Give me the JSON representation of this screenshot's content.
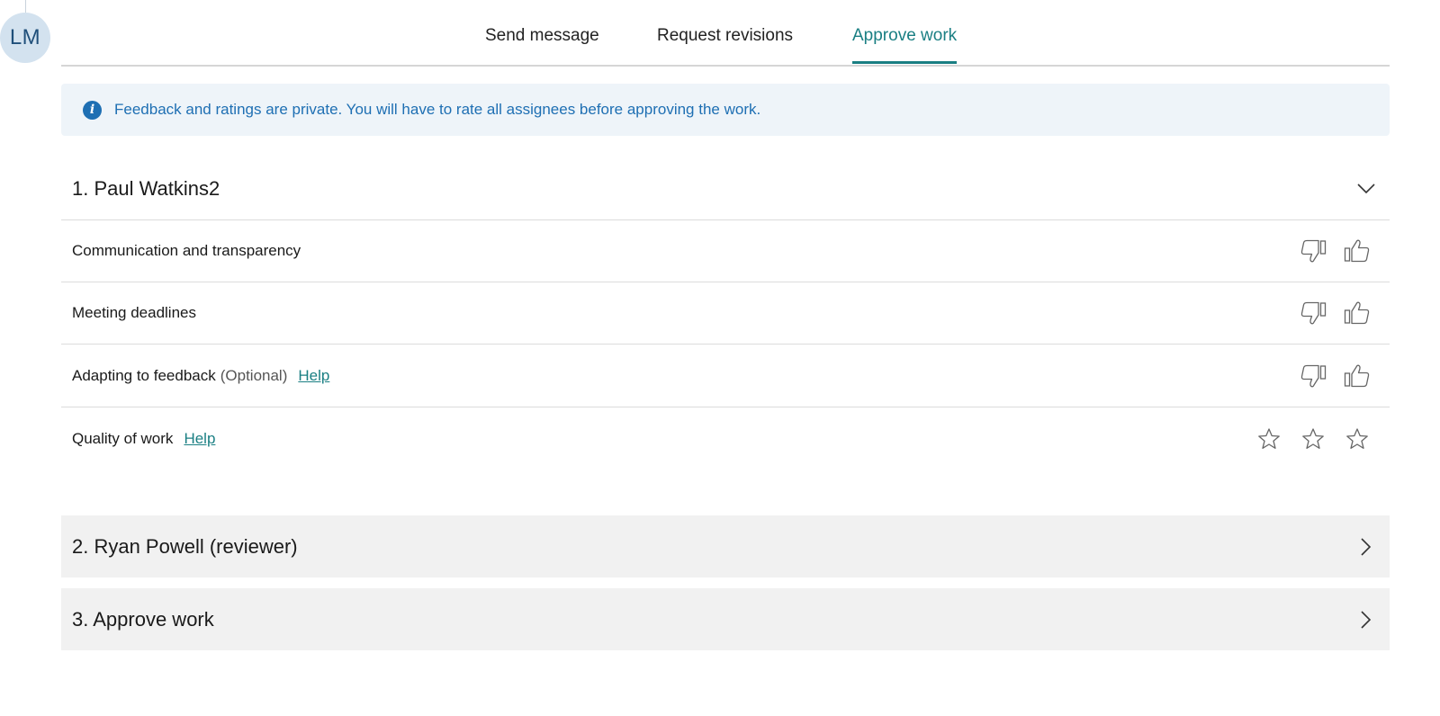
{
  "user": {
    "initials": "LM"
  },
  "tabs": [
    {
      "label": "Send message"
    },
    {
      "label": "Request revisions"
    },
    {
      "label": "Approve work",
      "active": true
    }
  ],
  "info_banner": {
    "icon": "info-icon",
    "text": "Feedback and ratings are private. You will have to rate all assignees before approving the work."
  },
  "sections": [
    {
      "title": "1. Paul Watkins2",
      "expanded": true,
      "criteria": [
        {
          "label": "Communication and transparency",
          "type": "thumbs"
        },
        {
          "label": "Meeting deadlines",
          "type": "thumbs"
        },
        {
          "label": "Adapting to feedback",
          "optional": "(Optional)",
          "help": "Help",
          "type": "thumbs"
        },
        {
          "label": "Quality of work",
          "help": "Help",
          "type": "stars",
          "stars": 3
        }
      ]
    },
    {
      "title": "2. Ryan Powell (reviewer)",
      "expanded": false
    },
    {
      "title": "3. Approve work",
      "expanded": false
    }
  ],
  "colors": {
    "accent": "#1a7f83",
    "info": "#1e6fb3",
    "info_bg": "#eef4f9",
    "collapsed_bg": "#f1f1f1"
  }
}
